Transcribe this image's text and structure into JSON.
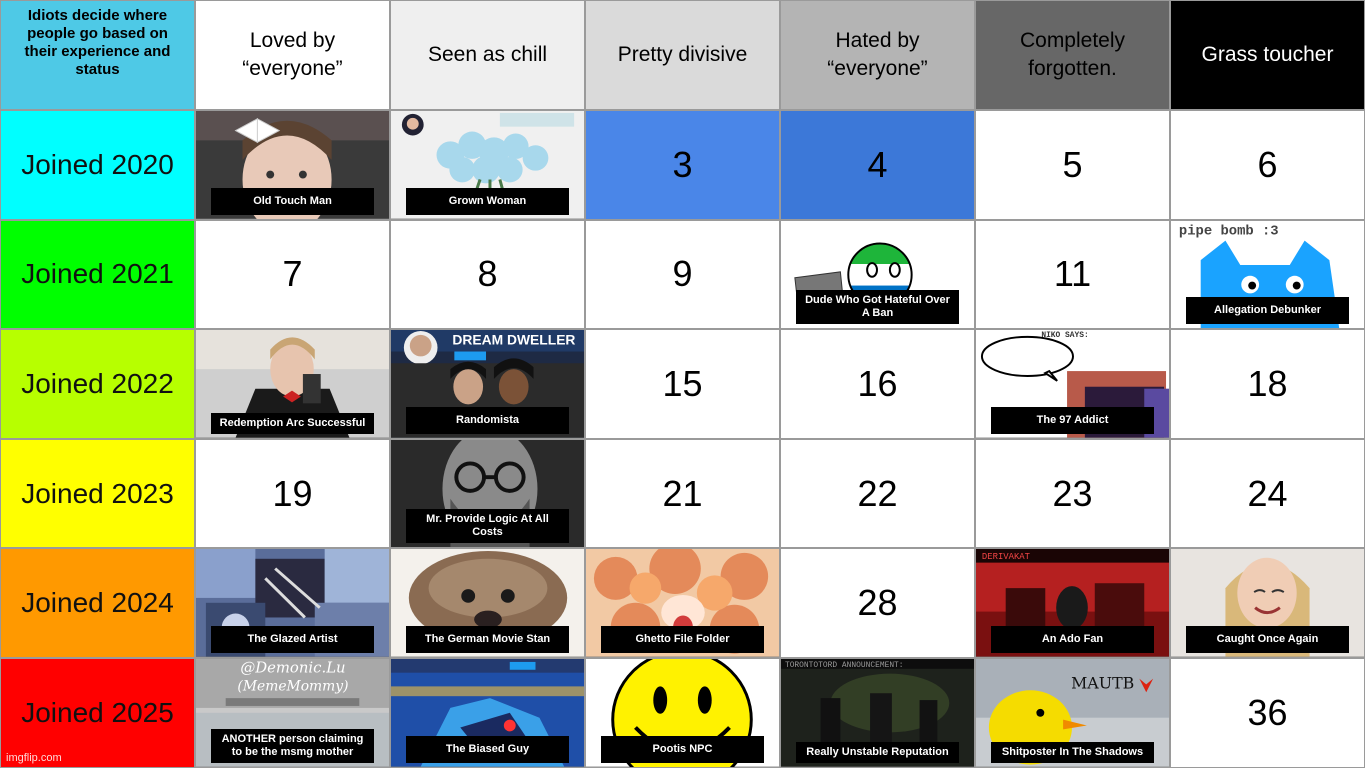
{
  "corner_title": "Idiots decide where people go based on their experience and status",
  "columns": [
    {
      "label": "Loved by “everyone”",
      "bg": "#ffffff",
      "fg": "#000000"
    },
    {
      "label": "Seen as chill",
      "bg": "#efefef",
      "fg": "#000000"
    },
    {
      "label": "Pretty divisive",
      "bg": "#dadada",
      "fg": "#000000"
    },
    {
      "label": "Hated by “everyone”",
      "bg": "#b4b4b4",
      "fg": "#000000"
    },
    {
      "label": "Completely forgotten.",
      "bg": "#676767",
      "fg": "#000000"
    },
    {
      "label": "Grass toucher",
      "bg": "#000000",
      "fg": "#ffffff"
    }
  ],
  "rows": [
    {
      "label": "Joined 2020",
      "color": "#00ffff",
      "cells": [
        {
          "type": "image",
          "caption": "Old Touch Man",
          "icon": "photo-person-bow"
        },
        {
          "type": "image",
          "caption": "Grown Woman",
          "icon": "photo-blue-flowers"
        },
        {
          "type": "number",
          "value": "3",
          "bg": "#4a86e8"
        },
        {
          "type": "number",
          "value": "4",
          "bg": "#3c78d8"
        },
        {
          "type": "number",
          "value": "5",
          "bg": "#ffffff"
        },
        {
          "type": "number",
          "value": "6",
          "bg": "#ffffff"
        }
      ]
    },
    {
      "label": "Joined 2021",
      "color": "#00ff00",
      "cells": [
        {
          "type": "number",
          "value": "7",
          "bg": "#ffffff"
        },
        {
          "type": "number",
          "value": "8",
          "bg": "#ffffff"
        },
        {
          "type": "number",
          "value": "9",
          "bg": "#ffffff"
        },
        {
          "type": "image",
          "caption": "Dude Who Got Hateful Over A Ban",
          "icon": "countryball-sierra-leone"
        },
        {
          "type": "number",
          "value": "11",
          "bg": "#ffffff"
        },
        {
          "type": "image",
          "caption": "Allegation Debunker",
          "icon": "blue-cat-pipe-bomb",
          "overlay_text": "pipe bomb :3"
        }
      ]
    },
    {
      "label": "Joined 2022",
      "color": "#b7ff00",
      "cells": [
        {
          "type": "image",
          "caption": "Redemption Arc Successful",
          "icon": "photo-person-suit"
        },
        {
          "type": "image",
          "caption": "Randomista",
          "icon": "banner-dream-dweller",
          "overlay_text": "DREAM DWELLER"
        },
        {
          "type": "number",
          "value": "15",
          "bg": "#ffffff"
        },
        {
          "type": "number",
          "value": "16",
          "bg": "#ffffff"
        },
        {
          "type": "image",
          "caption": "The 97 Addict",
          "icon": "niko-speech-bubble",
          "overlay_text": "NIKO SAYS:"
        },
        {
          "type": "number",
          "value": "18",
          "bg": "#ffffff"
        }
      ]
    },
    {
      "label": "Joined 2023",
      "color": "#ffff00",
      "cells": [
        {
          "type": "number",
          "value": "19",
          "bg": "#ffffff"
        },
        {
          "type": "image",
          "caption": "Mr. Provide Logic At All Costs",
          "icon": "photo-bearded-man"
        },
        {
          "type": "number",
          "value": "21",
          "bg": "#ffffff"
        },
        {
          "type": "number",
          "value": "22",
          "bg": "#ffffff"
        },
        {
          "type": "number",
          "value": "23",
          "bg": "#ffffff"
        },
        {
          "type": "number",
          "value": "24",
          "bg": "#ffffff"
        }
      ]
    },
    {
      "label": "Joined 2024",
      "color": "#ff9900",
      "cells": [
        {
          "type": "image",
          "caption": "The Glazed Artist",
          "icon": "art-collage"
        },
        {
          "type": "image",
          "caption": "The German Movie Stan",
          "icon": "photo-dog"
        },
        {
          "type": "image",
          "caption": "Ghetto File Folder",
          "icon": "art-autumn"
        },
        {
          "type": "number",
          "value": "28",
          "bg": "#ffffff"
        },
        {
          "type": "image",
          "caption": "An Ado Fan",
          "icon": "art-red-scene"
        },
        {
          "type": "image",
          "caption": "Caught Once Again",
          "icon": "photo-blonde-woman"
        }
      ]
    },
    {
      "label": "Joined 2025",
      "color": "#ff0000",
      "cells": [
        {
          "type": "image",
          "caption": "ANOTHER person claiming to be the msmg mother",
          "icon": "banner-demonic-lu",
          "overlay_text": "@Demonic.Lu (MemeMommy)"
        },
        {
          "type": "image",
          "caption": "The Biased Guy",
          "icon": "banner-blue-anime"
        },
        {
          "type": "image",
          "caption": "Pootis NPC",
          "icon": "smiley-face"
        },
        {
          "type": "image",
          "caption": "Really Unstable Reputation",
          "icon": "dark-soldiers"
        },
        {
          "type": "image",
          "caption": "Shitposter In The Shadows",
          "icon": "yellow-bird",
          "overlay_text": "MAUTB"
        },
        {
          "type": "number",
          "value": "36",
          "bg": "#ffffff"
        }
      ]
    }
  ],
  "watermark": "imgflip.com"
}
